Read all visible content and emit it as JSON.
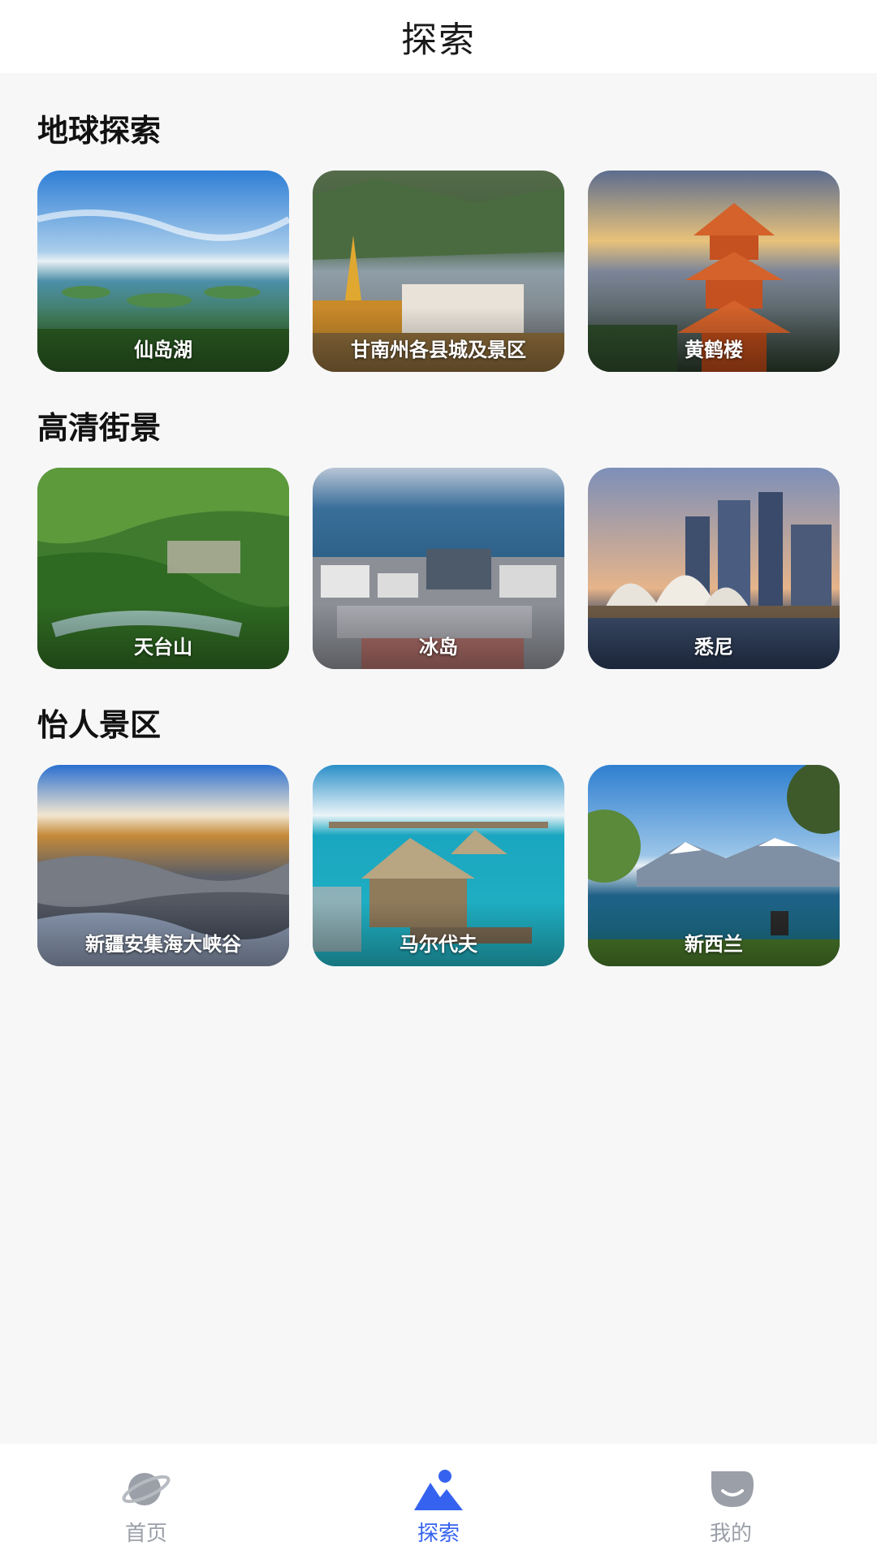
{
  "header": {
    "title": "探索"
  },
  "sections": [
    {
      "title": "地球探索",
      "cards": [
        {
          "label": "仙岛湖"
        },
        {
          "label": "甘南州各县城及景区"
        },
        {
          "label": "黄鹤楼"
        }
      ]
    },
    {
      "title": "高清街景",
      "cards": [
        {
          "label": "天台山"
        },
        {
          "label": "冰岛"
        },
        {
          "label": "悉尼"
        }
      ]
    },
    {
      "title": "怡人景区",
      "cards": [
        {
          "label": "新疆安集海大峡谷"
        },
        {
          "label": "马尔代夫"
        },
        {
          "label": "新西兰"
        }
      ]
    }
  ],
  "tabbar": {
    "tabs": [
      {
        "label": "首页",
        "icon": "planet-icon",
        "active": false
      },
      {
        "label": "探索",
        "icon": "mountain-icon",
        "active": true
      },
      {
        "label": "我的",
        "icon": "profile-icon",
        "active": false
      }
    ],
    "active_color": "#3563f0",
    "inactive_color": "#9a9fa8"
  }
}
